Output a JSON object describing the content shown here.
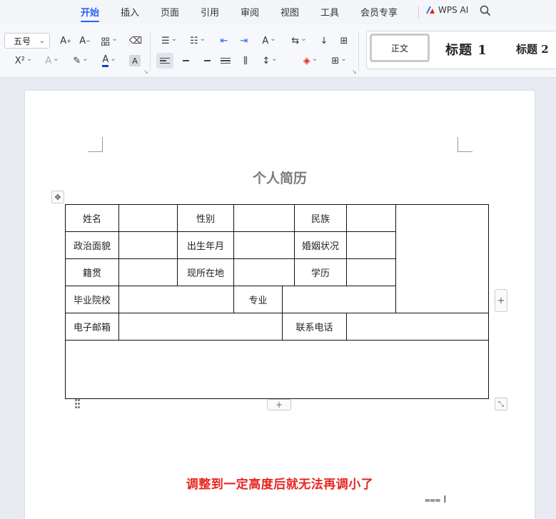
{
  "menu": {
    "tabs": [
      "开始",
      "插入",
      "页面",
      "引用",
      "审阅",
      "视图",
      "工具",
      "会员专享"
    ],
    "active_tab": "开始",
    "ai_label": "WPS AI",
    "accent_color": "#2a62f0"
  },
  "ribbon": {
    "font_size_value": "五号",
    "font_color": "#1a3cc8",
    "styles": {
      "normal": "正文",
      "heading1": "标题 1",
      "heading2": "标题 2"
    }
  },
  "document": {
    "title": "个人简历",
    "table": {
      "row1": [
        "姓名",
        "",
        "性别",
        "",
        "民族",
        ""
      ],
      "row2": [
        "政治面貌",
        "",
        "出生年月",
        "",
        "婚姻状况",
        ""
      ],
      "row3": [
        "籍贯",
        "",
        "现所在地",
        "",
        "学历",
        ""
      ],
      "row4": [
        "毕业院校",
        "",
        "专业",
        ""
      ],
      "row5": [
        "电子邮箱",
        "",
        "联系电话",
        ""
      ]
    },
    "caption": "调整到一定高度后就无法再调小了",
    "caption_color": "#e8241e"
  }
}
